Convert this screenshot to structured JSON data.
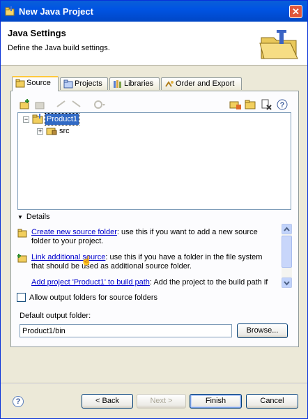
{
  "window": {
    "title": "New Java Project"
  },
  "header": {
    "title": "Java Settings",
    "description": "Define the Java build settings."
  },
  "tabs": [
    {
      "label": "Source"
    },
    {
      "label": "Projects"
    },
    {
      "label": "Libraries"
    },
    {
      "label": "Order and Export"
    }
  ],
  "tree": {
    "root": "Product1",
    "child": "src"
  },
  "details": {
    "title": "Details",
    "items": [
      {
        "link": "Create new source folder",
        "text": ": use this if you want to add a new source folder to your project."
      },
      {
        "link": "Link additional source",
        "text": ": use this if you have a folder in the file system that should be used as additional source folder."
      },
      {
        "link": "Add project 'Product1' to build path",
        "text": ": Add the project to the build path if"
      }
    ]
  },
  "options": {
    "allow_output_label": "Allow output folders for source folders",
    "allow_output_checked": false
  },
  "output": {
    "label": "Default output folder:",
    "value": "Product1/bin",
    "browse_label": "Browse..."
  },
  "buttons": {
    "back": "< Back",
    "next": "Next >",
    "finish": "Finish",
    "cancel": "Cancel"
  },
  "colors": {
    "titlebar": "#0054e3",
    "link": "#0000cc",
    "active_tab_top": "#ffc83c"
  }
}
